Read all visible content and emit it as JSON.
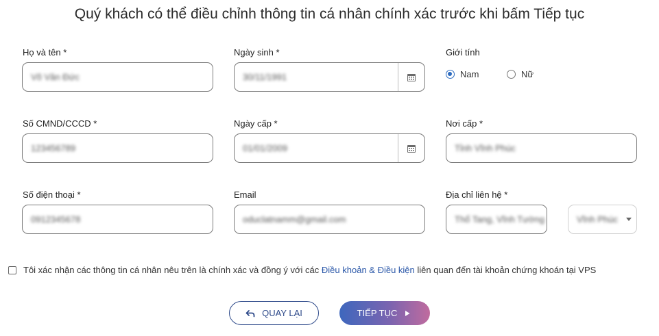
{
  "title": "Quý khách có thể điều chỉnh thông tin cá nhân chính xác trước khi bấm Tiếp tục",
  "fields": {
    "full_name": {
      "label": "Họ và tên",
      "value": "Võ Văn Đức"
    },
    "dob": {
      "label": "Ngày sinh",
      "value": "30/11/1991"
    },
    "gender": {
      "label": "Giới tính",
      "options": [
        "Nam",
        "Nữ"
      ],
      "selected": "Nam"
    },
    "id_number": {
      "label": "Số CMND/CCCD",
      "value": "123456789"
    },
    "issue_date": {
      "label": "Ngày cấp",
      "value": "01/01/2009"
    },
    "issue_place": {
      "label": "Nơi cấp",
      "value": "Tỉnh Vĩnh Phúc"
    },
    "phone": {
      "label": "Số điện thoại",
      "value": "0912345678"
    },
    "email": {
      "label": "Email",
      "value": "oduclatnamm@gmail.com"
    },
    "address": {
      "label": "Địa chỉ liên hệ",
      "value": "Thổ Tang, Vĩnh Tường",
      "province": "Vĩnh Phúc"
    }
  },
  "required_mark": "*",
  "consent": {
    "text_before": "Tôi xác nhận các thông tin cá nhân nêu trên là chính xác và đồng ý với các ",
    "link": "Điều khoản & Điều kiện",
    "text_after": " liên quan đến tài khoản chứng khoán tại VPS"
  },
  "buttons": {
    "back": "QUAY LẠI",
    "next": "TIẾP TỤC"
  },
  "colors": {
    "accent": "#2c6bbf",
    "link": "#2a57a8",
    "gradient_start": "#3e67bd",
    "gradient_end": "#c06b9e"
  }
}
